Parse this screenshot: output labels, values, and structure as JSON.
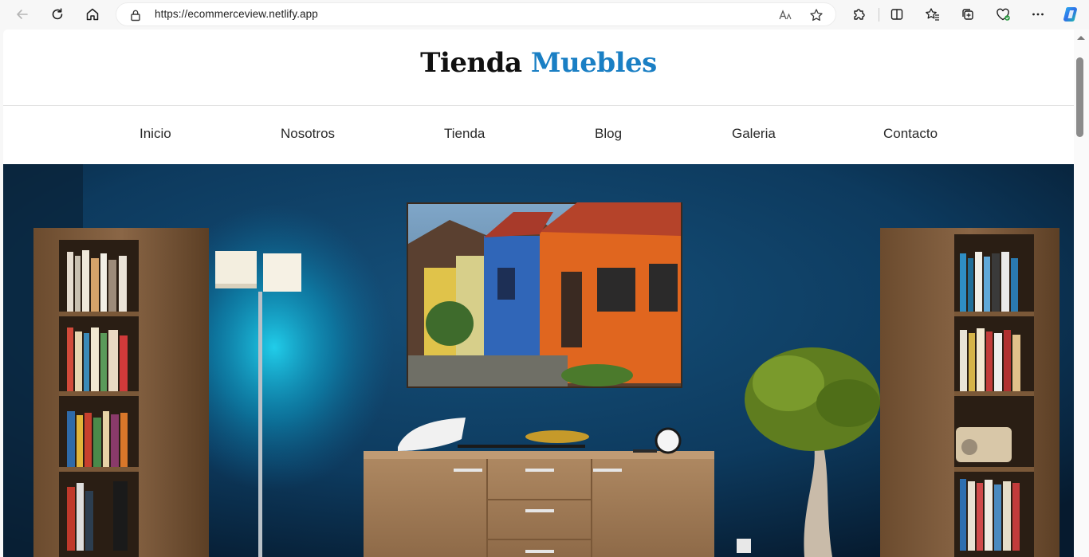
{
  "browser": {
    "url": "https://ecommerceview.netlify.app",
    "icons": [
      "back-icon",
      "reload-icon",
      "home-icon",
      "lock-icon",
      "read-aloud-icon",
      "favorite-star-icon",
      "extensions-icon",
      "split-screen-icon",
      "favorites-icon",
      "collections-icon",
      "browser-essentials-icon",
      "more-icon",
      "copilot-icon"
    ]
  },
  "site": {
    "logo_main": "Tienda",
    "logo_accent": "Muebles",
    "accent_color": "#1a7fc4"
  },
  "nav": {
    "items": [
      {
        "label": "Inicio"
      },
      {
        "label": "Nosotros"
      },
      {
        "label": "Tienda"
      },
      {
        "label": "Blog"
      },
      {
        "label": "Galeria"
      },
      {
        "label": "Contacto"
      }
    ]
  },
  "hero": {
    "image": "living-room-blue-wall-painting-lamp-dresser-bookshelves",
    "wall_color": "#0e3557"
  }
}
